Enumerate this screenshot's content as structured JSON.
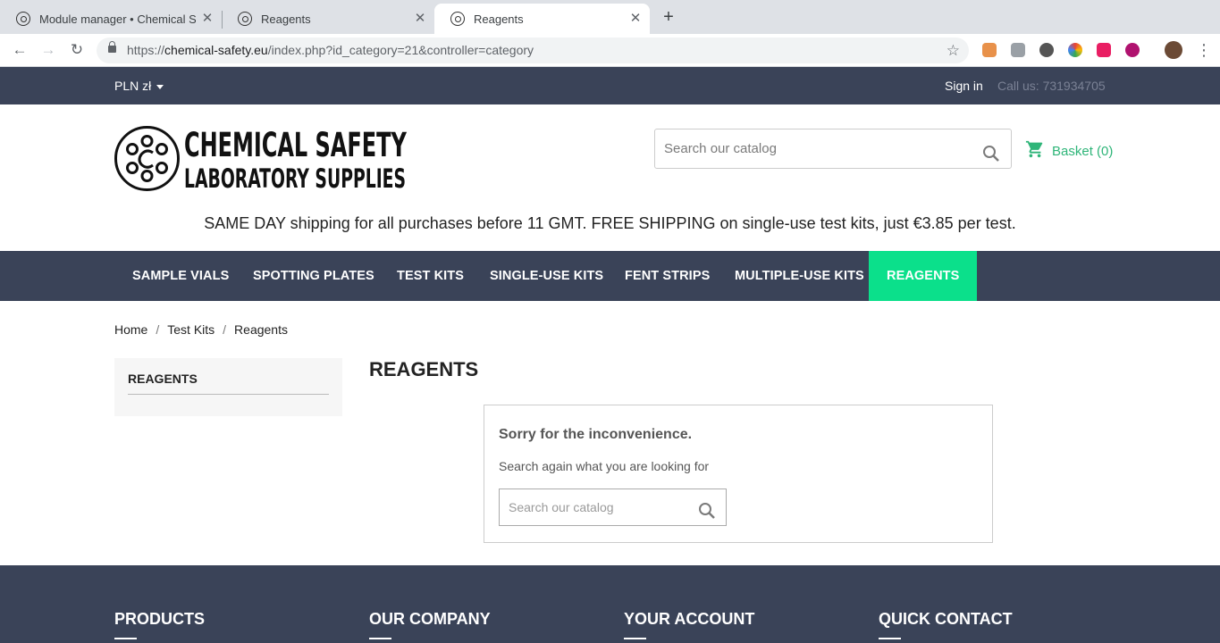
{
  "browser": {
    "tabs": [
      {
        "title": "Module manager • Chemical Safety",
        "close": "✕"
      },
      {
        "title": "Reagents",
        "close": "✕"
      },
      {
        "title": "Reagents",
        "close": "✕"
      }
    ],
    "new_tab": "+",
    "url_prefix": "https://",
    "url_host": "chemical-safety.eu",
    "url_path": "/index.php?id_category=21&controller=category"
  },
  "topbar": {
    "currency": "PLN zł",
    "sign_in": "Sign in",
    "call_us": "Call us: 731934705"
  },
  "header": {
    "logo_line1": "CHEMICAL SAFETY",
    "logo_line2": "LABORATORY SUPPLIES",
    "search_placeholder": "Search our catalog",
    "basket": "Basket (0)"
  },
  "promo": "SAME DAY shipping for all purchases before 11 GMT. FREE SHIPPING on single-use test kits, just €3.85 per test.",
  "nav": [
    {
      "label": "SAMPLE VIALS"
    },
    {
      "label": "SPOTTING PLATES"
    },
    {
      "label": "TEST KITS"
    },
    {
      "label": "SINGLE-USE KITS"
    },
    {
      "label": "FENT STRIPS"
    },
    {
      "label": "MULTIPLE-USE KITS"
    },
    {
      "label": "REAGENTS"
    }
  ],
  "breadcrumb": [
    "Home",
    "Test Kits",
    "Reagents"
  ],
  "sidebar": {
    "title": "REAGENTS"
  },
  "page_title": "REAGENTS",
  "not_found": {
    "heading": "Sorry for the inconvenience.",
    "subtext": "Search again what you are looking for",
    "search_placeholder": "Search our catalog"
  },
  "footer": {
    "columns": [
      "PRODUCTS",
      "OUR COMPANY",
      "YOUR ACCOUNT",
      "QUICK CONTACT"
    ]
  },
  "colors": {
    "brand_dark": "#3a4358",
    "accent_green": "#0be08b",
    "basket_green": "#2fb579"
  }
}
